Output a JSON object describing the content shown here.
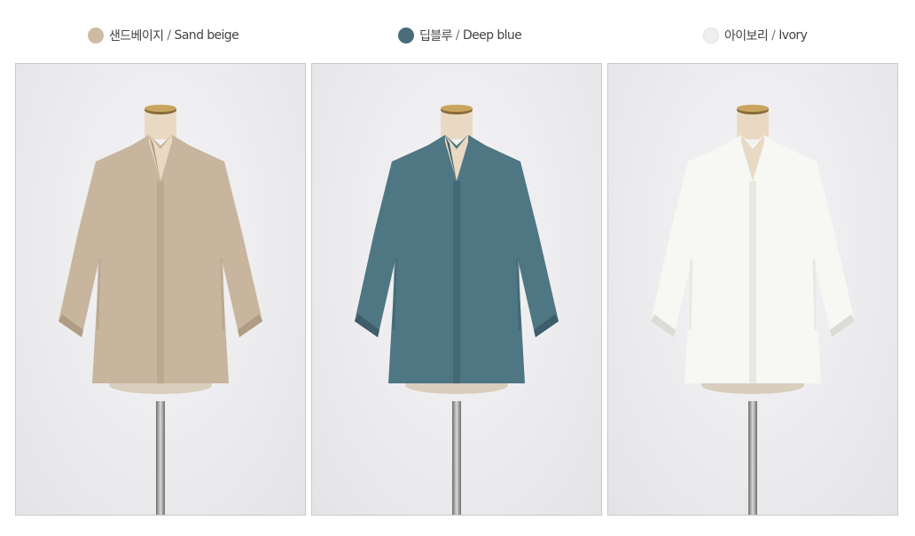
{
  "variants": [
    {
      "name_ko": "샌드베이지",
      "separator": "/",
      "name_en": "Sand beige",
      "swatch_color": "#cfbba3",
      "garment_color": "#c8b59d",
      "garment_shadow": "#b09c84",
      "image_icon": "blouse-photo-sand-beige"
    },
    {
      "name_ko": "딥블루",
      "separator": "/",
      "name_en": "Deep blue",
      "swatch_color": "#4b6c79",
      "garment_color": "#4f7683",
      "garment_shadow": "#3c5d69",
      "image_icon": "blouse-photo-deep-blue"
    },
    {
      "name_ko": "아이보리",
      "separator": "/",
      "name_en": "Ivory",
      "swatch_color": "#efefef",
      "garment_color": "#f7f7f3",
      "garment_shadow": "#dcdcd6",
      "image_icon": "blouse-photo-ivory"
    }
  ]
}
